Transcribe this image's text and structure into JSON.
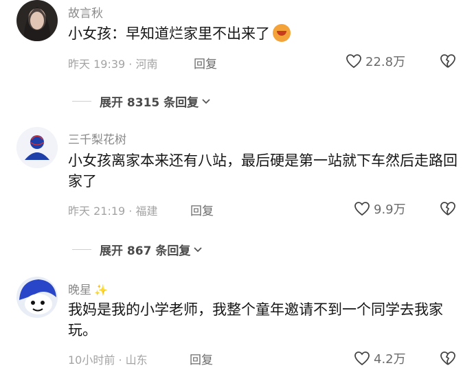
{
  "comments": [
    {
      "username": "故言秋",
      "text": "小女孩：早知道烂家里不出来了",
      "time": "昨天 19:39",
      "location": "河南",
      "reply_label": "回复",
      "likes": "22.8万",
      "expand_label": "展开 8315 条回复"
    },
    {
      "username": "三千梨花树",
      "text": "小女孩离家本来还有八站，最后硬是第一站就下车然后走路回家了",
      "time": "昨天 21:19",
      "location": "福建",
      "reply_label": "回复",
      "likes": "9.9万",
      "expand_label": "展开 867 条回复"
    },
    {
      "username": "晚星",
      "text": "我妈是我的小学老师，我整个童年邀请不到一个同学去我家玩。",
      "time": "10小时前",
      "location": "山东",
      "reply_label": "回复",
      "likes": "4.2万"
    }
  ],
  "meta_separator": "·"
}
